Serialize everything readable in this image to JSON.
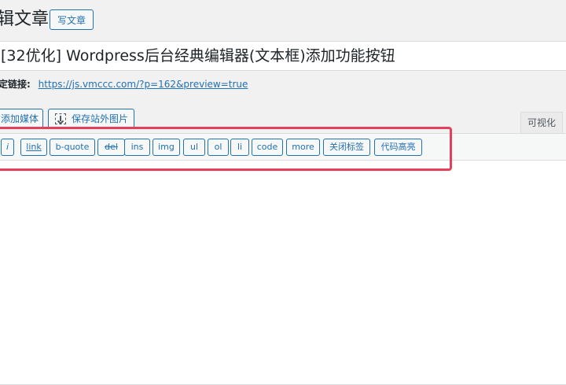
{
  "header": {
    "page_title": "辑文章",
    "add_new_label": "写文章"
  },
  "post": {
    "title_value": "[32优化] Wordpress后台经典编辑器(文本框)添加功能按钮",
    "permalink_label": "定链接:",
    "permalink_url": "https://js.vmccc.com/?p=162&preview=true"
  },
  "media_buttons": {
    "add_media_label": "添加媒体",
    "save_remote_label": "保存站外图片"
  },
  "editor_tabs": {
    "visual_label": "可视化"
  },
  "quicktags": [
    {
      "label": "i"
    },
    {
      "label": "link"
    },
    {
      "label": "b-quote"
    },
    {
      "label": "del"
    },
    {
      "label": "ins"
    },
    {
      "label": "img"
    },
    {
      "label": "ul"
    },
    {
      "label": "ol"
    },
    {
      "label": "li"
    },
    {
      "label": "code"
    },
    {
      "label": "more"
    },
    {
      "label": "关闭标签"
    },
    {
      "label": "代码高亮"
    }
  ],
  "colors": {
    "accent": "#2271b1",
    "highlight_annotation": "#e5405a"
  }
}
